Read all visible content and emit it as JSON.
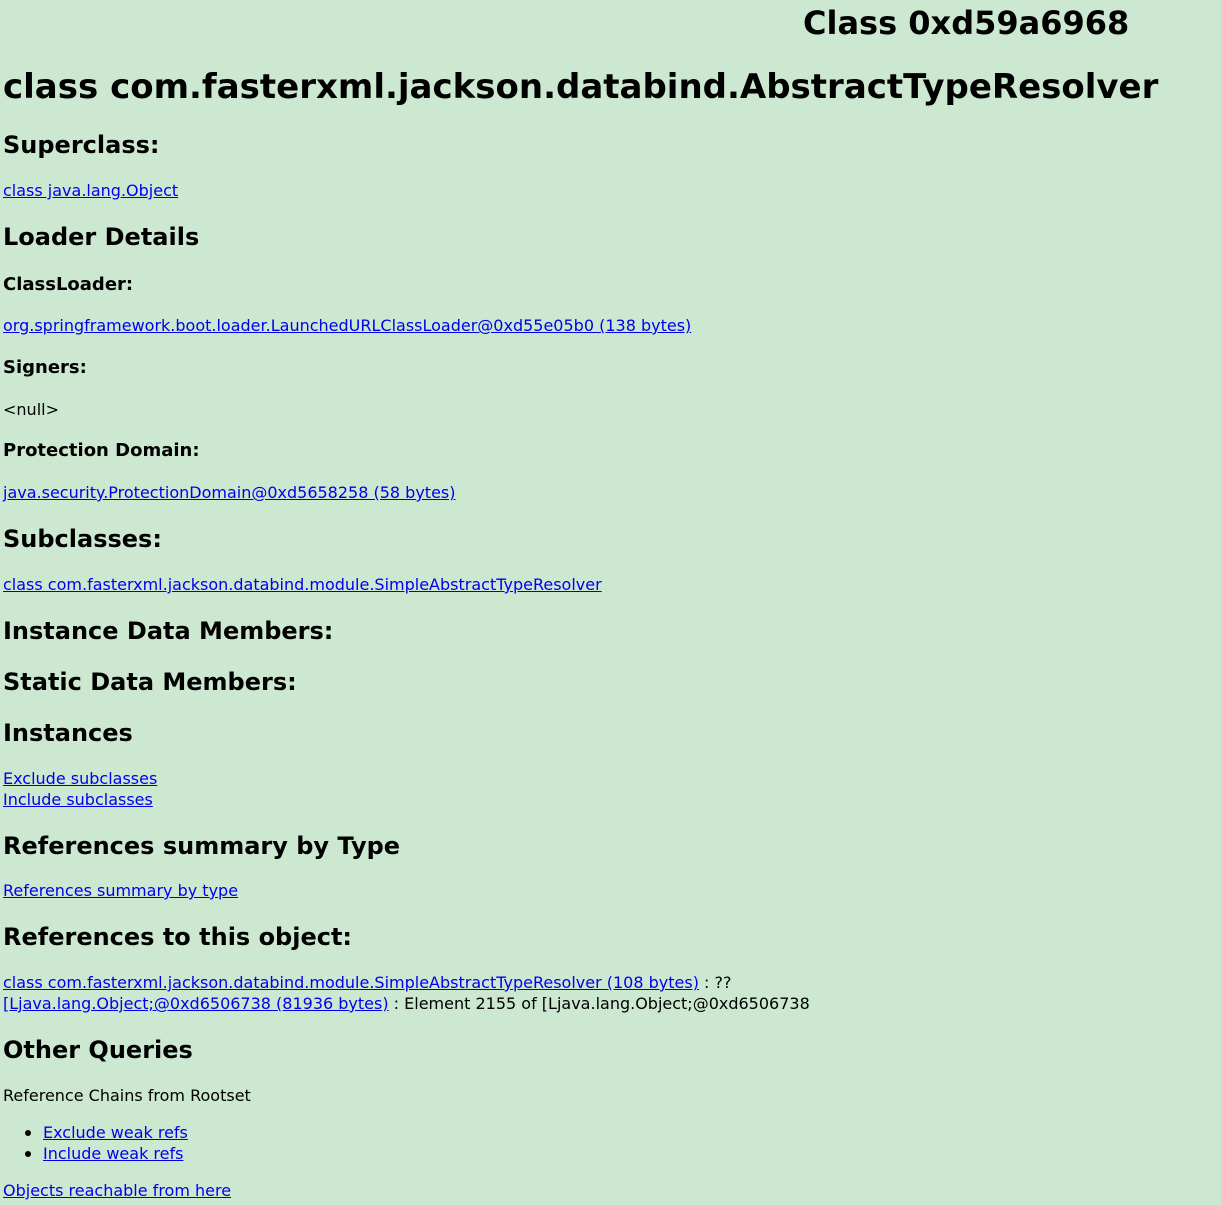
{
  "page": {
    "window_title": "Class 0xd59a6968",
    "class_heading": "class com.fasterxml.jackson.databind.AbstractTypeResolver"
  },
  "superclass": {
    "heading": "Superclass:",
    "link": "class java.lang.Object"
  },
  "loader_details": {
    "heading": "Loader Details",
    "classloader_label": "ClassLoader:",
    "classloader_link": "org.springframework.boot.loader.LaunchedURLClassLoader@0xd55e05b0 (138 bytes)",
    "signers_label": "Signers:",
    "signers_value": "<null>",
    "protection_domain_label": "Protection Domain:",
    "protection_domain_link": "java.security.ProtectionDomain@0xd5658258 (58 bytes)"
  },
  "subclasses": {
    "heading": "Subclasses:",
    "link": "class com.fasterxml.jackson.databind.module.SimpleAbstractTypeResolver"
  },
  "instance_data_members": {
    "heading": "Instance Data Members:"
  },
  "static_data_members": {
    "heading": "Static Data Members:"
  },
  "instances": {
    "heading": "Instances",
    "exclude_link": "Exclude subclasses",
    "include_link": "Include subclasses"
  },
  "references_summary": {
    "heading": "References summary by Type",
    "link": "References summary by type"
  },
  "references_to": {
    "heading": "References to this object:",
    "rows": [
      {
        "link": "class com.fasterxml.jackson.databind.module.SimpleAbstractTypeResolver (108 bytes)",
        "detail": " : ??"
      },
      {
        "link": "[Ljava.lang.Object;@0xd6506738 (81936 bytes)",
        "detail": " : Element 2155 of [Ljava.lang.Object;@0xd6506738"
      }
    ]
  },
  "other_queries": {
    "heading": "Other Queries",
    "chains_label": "Reference Chains from Rootset",
    "exclude_weak_link": "Exclude weak refs",
    "include_weak_link": "Include weak refs",
    "reachable_link": "Objects reachable from here"
  }
}
